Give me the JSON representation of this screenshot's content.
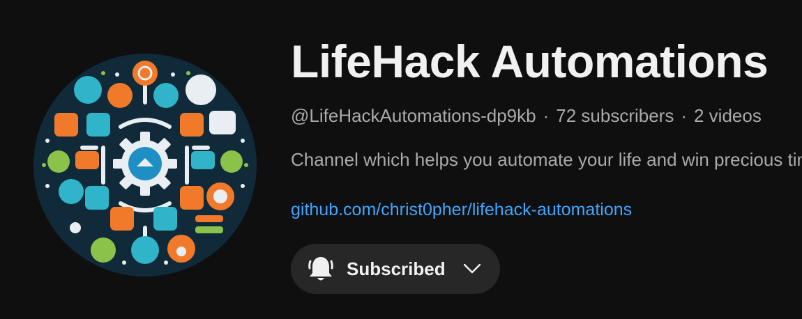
{
  "channel": {
    "title": "LifeHack Automations",
    "handle": "@LifeHackAutomations-dp9kb",
    "subscribers": "72 subscribers",
    "videos": "2 videos",
    "separator": "·",
    "description": "Channel which helps you automate your life and win precious time",
    "link": "github.com/christ0pher/lifehack-automations"
  },
  "subscribe_button": {
    "label": "Subscribed",
    "icon": "bell-icon",
    "dropdown_icon": "chevron-down-icon"
  },
  "colors": {
    "background": "#0f0f0f",
    "title": "#f1f1f1",
    "secondary_text": "#aaaaaa",
    "link": "#3ea6ff",
    "button_bg": "#272727"
  }
}
